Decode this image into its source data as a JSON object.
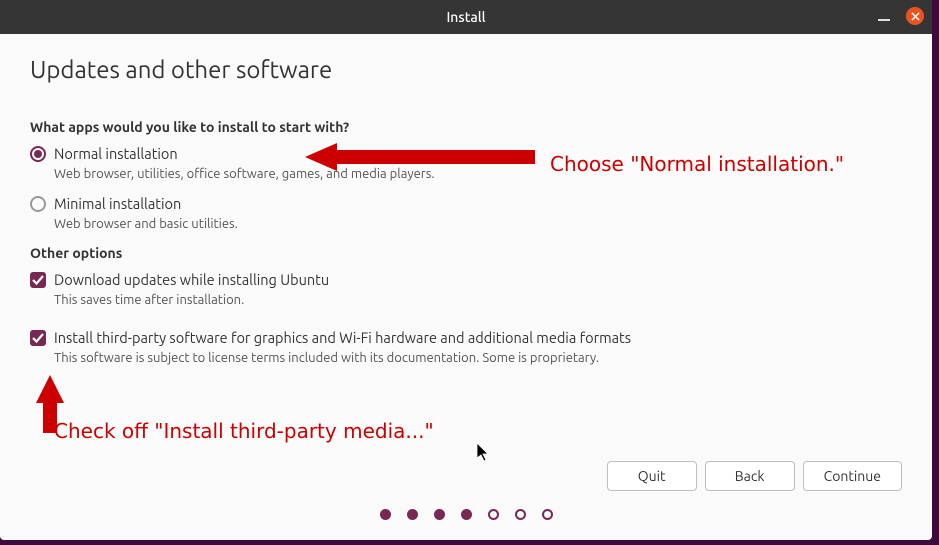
{
  "window": {
    "title": "Install"
  },
  "heading": "Updates and other software",
  "question_apps": "What apps would you like to install to start with?",
  "options": {
    "normal": {
      "label": "Normal installation",
      "desc": "Web browser, utilities, office software, games, and media players."
    },
    "minimal": {
      "label": "Minimal installation",
      "desc": "Web browser and basic utilities."
    }
  },
  "other_options_label": "Other options",
  "updates": {
    "label": "Download updates while installing Ubuntu",
    "desc": "This saves time after installation."
  },
  "thirdparty": {
    "label": "Install third-party software for graphics and Wi-Fi hardware and additional media formats",
    "desc": "This software is subject to license terms included with its documentation. Some is proprietary."
  },
  "buttons": {
    "quit": "Quit",
    "back": "Back",
    "continue": "Continue"
  },
  "annotations": {
    "choose_normal": "Choose \"Normal installation.\"",
    "check_thirdparty": "Check off \"Install third-party media...\""
  },
  "progress": {
    "total": 7,
    "current": 4
  }
}
